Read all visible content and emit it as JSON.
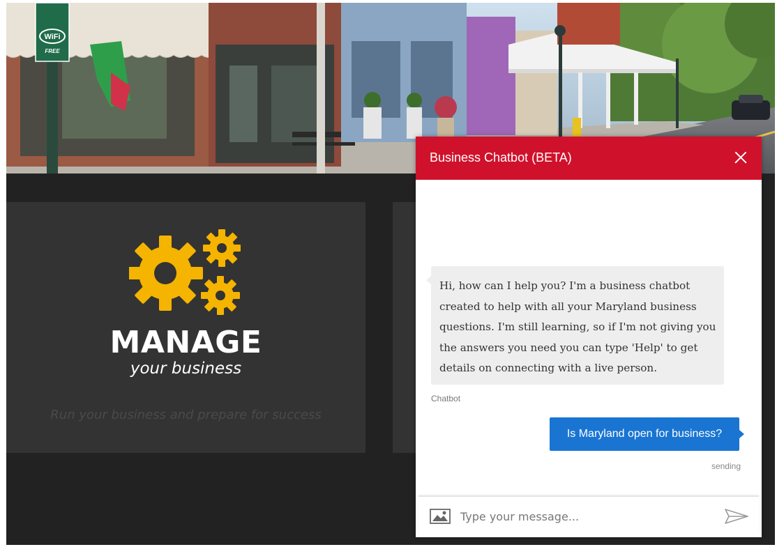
{
  "chatbot": {
    "title": "Business Chatbot (BETA)",
    "close_icon": "close-icon",
    "bot_message": "Hi, how can I help you? I'm a business chatbot created to help with all your Maryland business questions. I'm still learning, so if I'm not giving you the answers you need you can type 'Help' to get details on connecting with a live person.",
    "bot_sender_label": "Chatbot",
    "user_message": "Is Maryland open for business?",
    "user_status": "sending",
    "input_placeholder": "Type your message...",
    "input_value": "",
    "image_icon": "image-upload-icon",
    "send_icon": "send-icon"
  },
  "manage_card": {
    "icon": "gears-icon",
    "title": "MANAGE",
    "subtitle": "your business",
    "description": "Run your business and prepare for success"
  },
  "hero": {
    "sign_text": "WiFi",
    "sign_sub": "FREE"
  },
  "colors": {
    "chat_header": "#d0112b",
    "user_bubble": "#1a75d2",
    "bot_bubble": "#eeeeee",
    "gear": "#f5b400",
    "card_bg": "#333333",
    "page_bg": "#222222"
  }
}
